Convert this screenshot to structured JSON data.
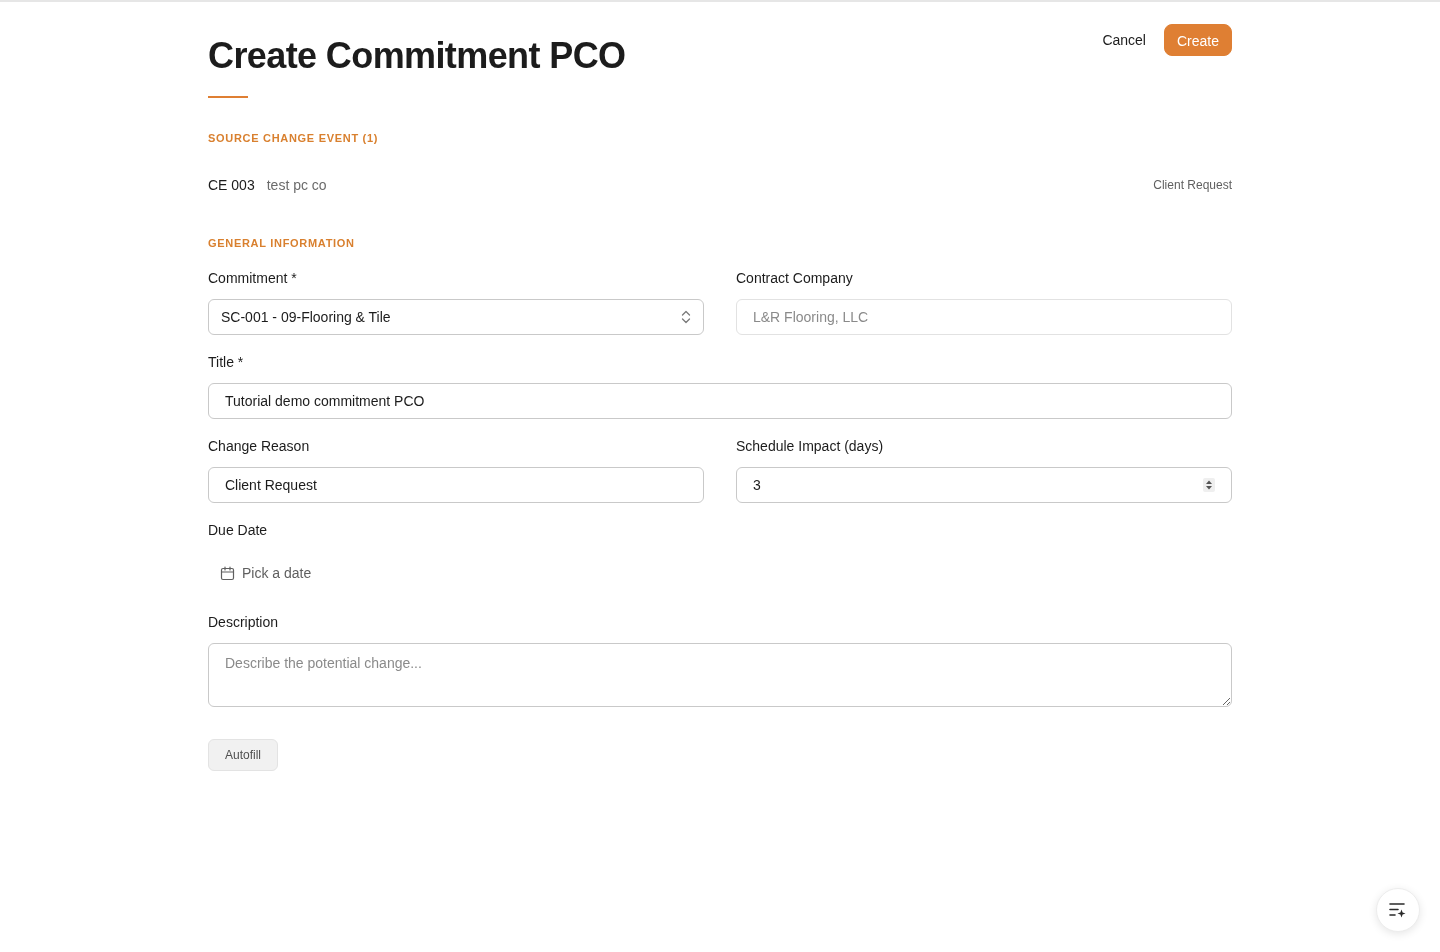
{
  "header": {
    "title": "Create Commitment PCO",
    "actions": [
      {
        "label": "Cancel",
        "kind": "link"
      },
      {
        "label": "Create",
        "kind": "primary"
      }
    ]
  },
  "source_change_events": {
    "heading": "SOURCE CHANGE EVENT (1)",
    "items": [
      {
        "number": "CE 003",
        "title": "test pc co",
        "reason": "Client Request"
      }
    ]
  },
  "general_information": {
    "heading": "GENERAL INFORMATION",
    "rows": [
      [
        {
          "label": "Commitment *",
          "kind": "select",
          "value": "SC-001 - 09-Flooring & Tile",
          "disabled": false
        },
        {
          "label": "Contract Company",
          "kind": "text",
          "value": "L&R Flooring, LLC",
          "disabled": true
        }
      ],
      [
        {
          "label": "Title *",
          "kind": "text",
          "value": "Tutorial demo commitment PCO",
          "disabled": false
        }
      ],
      [
        {
          "label": "Change Reason",
          "kind": "text",
          "value": "Client Request",
          "disabled": false
        },
        {
          "label": "Schedule Impact (days)",
          "kind": "number",
          "value": "3",
          "disabled": false
        }
      ],
      [
        {
          "label": "Due Date",
          "kind": "date",
          "placeholder": "Pick a date",
          "disabled": false
        }
      ],
      [
        {
          "label": "Description",
          "kind": "textarea",
          "placeholder": "Describe the potential change...",
          "disabled": false
        }
      ]
    ]
  },
  "autofill_button": {
    "label": "Autofill"
  }
}
